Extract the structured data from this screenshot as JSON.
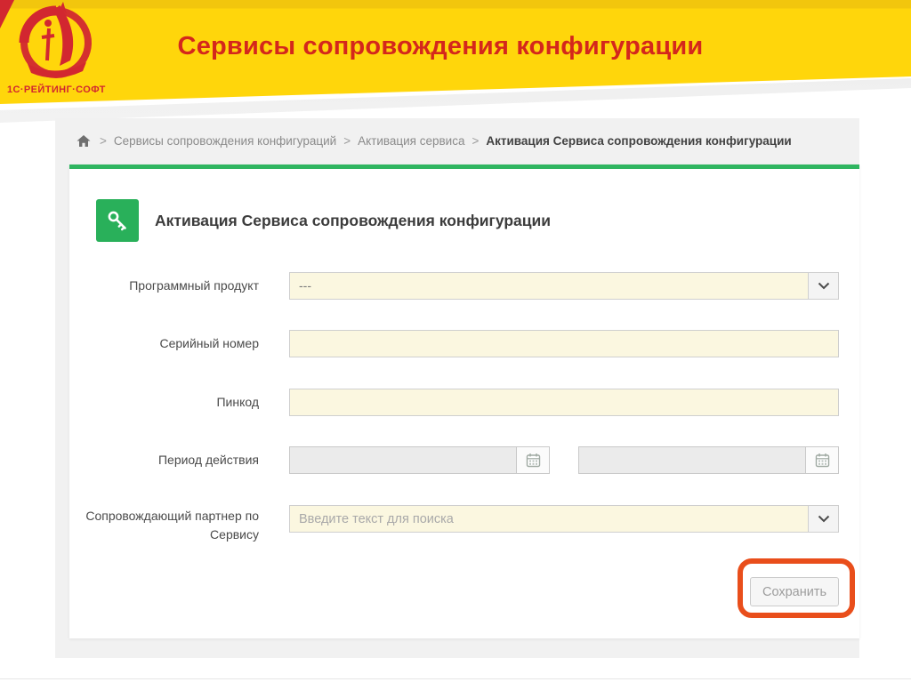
{
  "header": {
    "title": "Сервисы сопровождения конфигурации",
    "logo_text": "1С·РЕЙТИНГ·СОФТ",
    "colors": {
      "band_yellow": "#ffd60b",
      "title_red": "#d4271c",
      "logo_red": "#d22730"
    }
  },
  "breadcrumb": {
    "separator": ">",
    "items": [
      {
        "label": "Сервисы сопровождения конфигураций"
      },
      {
        "label": "Активация сервиса"
      },
      {
        "label": "Активация Сервиса сопровождения конфигурации"
      }
    ]
  },
  "panel": {
    "title": "Активация Сервиса сопровождения конфигурации",
    "accent_green": "#2fb560"
  },
  "form": {
    "product": {
      "label": "Программный продукт",
      "value": "---"
    },
    "serial": {
      "label": "Серийный номер",
      "value": ""
    },
    "pincode": {
      "label": "Пинкод",
      "value": ""
    },
    "period": {
      "label": "Период действия",
      "value_from": "",
      "value_to": ""
    },
    "partner": {
      "label": "Сопровождающий партнер по Сервису",
      "value": "",
      "placeholder": "Введите текст для поиска"
    },
    "save_label": "Сохранить"
  },
  "annotation": {
    "highlight_color": "#e94e1b"
  }
}
